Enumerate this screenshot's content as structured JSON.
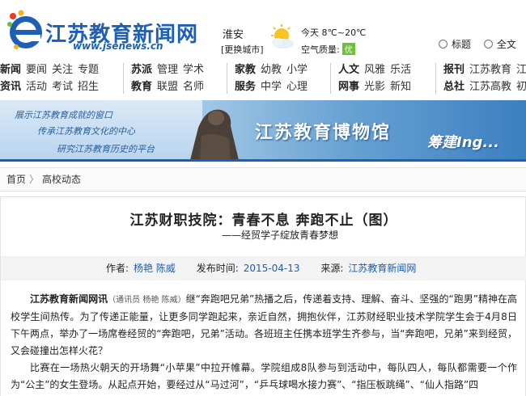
{
  "site": {
    "title": "江苏教育新闻网",
    "url": "www.jsenews.cn"
  },
  "location": {
    "city": "淮安",
    "change_label": "[更换城市]"
  },
  "weather": {
    "today": "今天 8℃~20℃",
    "air_label": "空气质量:",
    "air_value": "优",
    "air_color": "#6fbf3a"
  },
  "search_scope": {
    "options": [
      "标题",
      "全文"
    ]
  },
  "nav": {
    "groups": [
      {
        "rows": [
          {
            "head": "新闻",
            "items": [
              "要闻",
              "关注",
              "专题"
            ]
          },
          {
            "head": "资讯",
            "items": [
              "活动",
              "考试",
              "招生"
            ]
          }
        ]
      },
      {
        "rows": [
          {
            "head": "苏派",
            "items": [
              "管理",
              "学术"
            ]
          },
          {
            "head": "教育",
            "items": [
              "联盟",
              "名师"
            ]
          }
        ]
      },
      {
        "rows": [
          {
            "head": "家教",
            "items": [
              "幼教",
              "小学"
            ]
          },
          {
            "head": "服务",
            "items": [
              "中学",
              "心理"
            ]
          }
        ]
      },
      {
        "rows": [
          {
            "head": "人文",
            "items": [
              "风雅",
              "乐活"
            ]
          },
          {
            "head": "网事",
            "items": [
              "光影",
              "新知"
            ]
          }
        ]
      },
      {
        "rows": [
          {
            "head": "报刊",
            "items": [
              "江苏教育",
              "江"
            ]
          },
          {
            "head": "总社",
            "items": [
              "江苏高教",
              "初"
            ]
          }
        ]
      }
    ]
  },
  "banner": {
    "lines": [
      "展示江苏教育成就的窗口",
      "传承江苏教育文化的中心",
      "研究江苏教育历史的平台"
    ],
    "title": "江苏教育博物馆",
    "tag": "筹建Ing..."
  },
  "breadcrumb": {
    "home": "首页",
    "separator": "〉",
    "current": "高校动态"
  },
  "article": {
    "title": "江苏财职技院：青春不息  奔跑不止（图）",
    "subtitle": "——经贸学子绽放青春梦想",
    "author_label": "作者:",
    "author": "杨艳  陈威",
    "time_label": "发布时间:",
    "time": "2015-04-13",
    "source_label": "来源:",
    "source": "江苏教育新闻网",
    "lead_source": "江苏教育新闻网讯",
    "lead_reporters": "（通讯员  杨艳  陈威）",
    "para1": "继“奔跑吧兄弟”热播之后，传递着支持、理解、奋斗、坚强的“跑男”精神在高校学生间热传。为了传递正能量，让更多同学跑起来，亲近自然，拥抱伙伴，江苏财经职业技术学院学生会于4月8日下午两点，举办了一场席卷经贸的“奔跑吧，兄弟”活动。各班班主任携本班学生齐参与，当“奔跑吧，兄弟”来到经贸，又会碰撞出怎样火花？",
    "para2": "比赛在一场热火朝天的开场舞“小苹果”中拉开帷幕。学院组成8队参与到活动中，每队四人，每队都需要一个作为“公主”的女生登场。从起点开始，要经过从“马过河”，“乒乓球喝水接力赛”、“指压板跳绳”、“仙人指路”四"
  }
}
